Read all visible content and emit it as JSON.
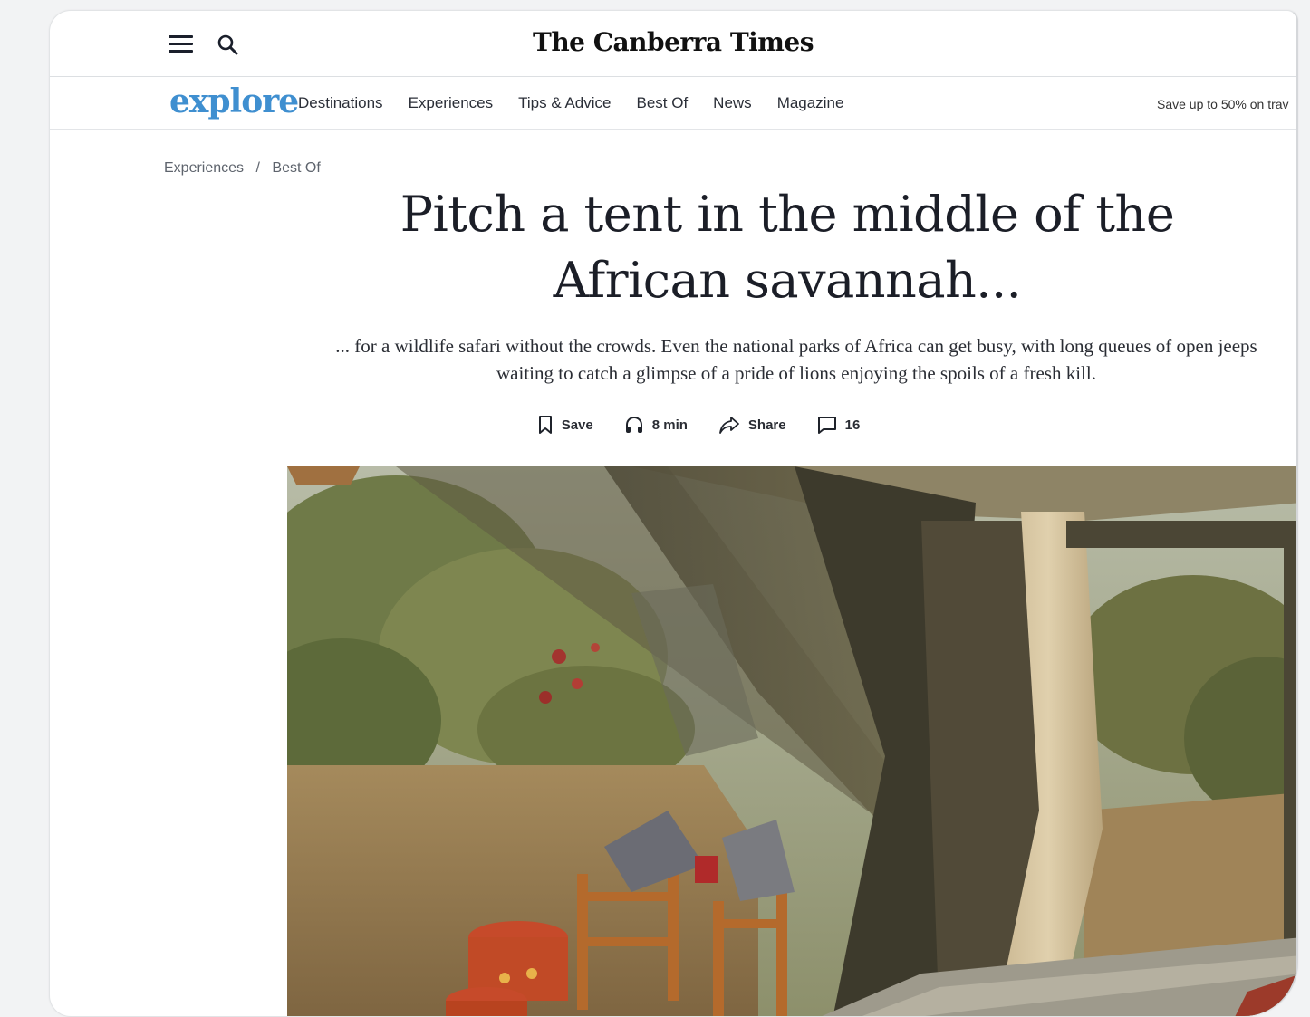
{
  "masthead": {
    "brand": "The Canberra Times",
    "menu_icon": "hamburger-menu-icon",
    "search_icon": "search-icon"
  },
  "navbar": {
    "logo": "explore",
    "logo_color": "#3f8fd0",
    "links": [
      "Destinations",
      "Experiences",
      "Tips & Advice",
      "Best Of",
      "News",
      "Magazine"
    ],
    "promo": "Save up to 50% on trav"
  },
  "breadcrumb": {
    "items": [
      "Experiences",
      "Best Of"
    ],
    "separator": "/"
  },
  "article": {
    "title_line1": "Pitch a tent in the middle of the",
    "title_line2": "African savannah...",
    "standfirst_line1": "... for a wildlife safari without the crowds. Even the national parks of Africa can get busy, with long queues of open jeeps",
    "standfirst_line2": "waiting to catch a glimpse of a pride of lions enjoying the spoils of a fresh kill.",
    "actions": {
      "save": "Save",
      "listen": "8 min",
      "share": "Share",
      "comments": "16"
    },
    "hero_image": "safari-tent-photo"
  }
}
